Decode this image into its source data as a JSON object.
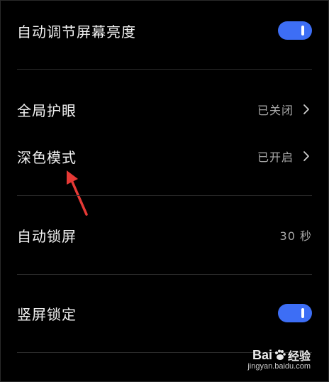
{
  "settings": {
    "auto_brightness": {
      "label": "自动调节屏幕亮度",
      "on": true
    },
    "eye_protection": {
      "label": "全局护眼",
      "value": "已关闭"
    },
    "dark_mode": {
      "label": "深色模式",
      "value": "已开启"
    },
    "auto_lock": {
      "label": "自动锁屏",
      "value": "30 秒"
    },
    "portrait_lock": {
      "label": "竖屏锁定",
      "on": true
    }
  },
  "watermark": {
    "brand_a": "Bai",
    "brand_b": "经验",
    "url": "jingyan.baidu.com"
  },
  "icons": {
    "chevron": "chevron-right-icon",
    "toggle": "toggle-switch-icon",
    "pointer": "red-arrow-annotation-icon"
  },
  "colors": {
    "background": "#000000",
    "accent": "#3d6ef5",
    "annotation": "#e53935",
    "secondary_text": "#a9a9a9"
  }
}
